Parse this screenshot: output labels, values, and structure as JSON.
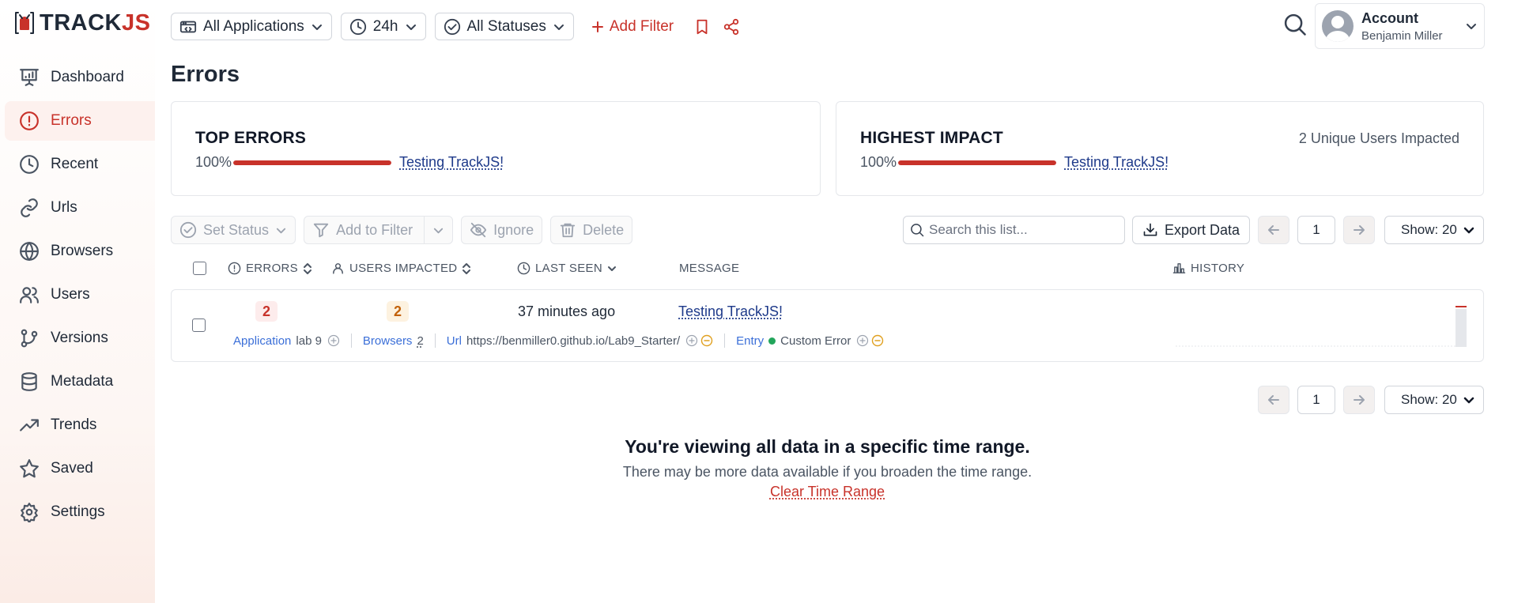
{
  "brand": {
    "prefix": "TRACK",
    "suffix": "JS"
  },
  "nav": [
    {
      "label": "Dashboard",
      "icon": "presentation-icon"
    },
    {
      "label": "Errors",
      "icon": "alert-circle-icon",
      "active": true
    },
    {
      "label": "Recent",
      "icon": "clock-icon"
    },
    {
      "label": "Urls",
      "icon": "link-icon"
    },
    {
      "label": "Browsers",
      "icon": "globe-icon"
    },
    {
      "label": "Users",
      "icon": "users-icon"
    },
    {
      "label": "Versions",
      "icon": "git-branch-icon"
    },
    {
      "label": "Metadata",
      "icon": "database-icon"
    },
    {
      "label": "Trends",
      "icon": "trend-icon"
    },
    {
      "label": "Saved",
      "icon": "star-icon"
    },
    {
      "label": "Settings",
      "icon": "gear-icon"
    }
  ],
  "topbar": {
    "applications": "All Applications",
    "range": "24h",
    "statuses": "All Statuses",
    "add_filter": "Add Filter"
  },
  "account": {
    "title": "Account",
    "user": "Benjamin Miller"
  },
  "page": {
    "title": "Errors"
  },
  "top_errors": {
    "title": "TOP ERRORS",
    "percent_label": "100%",
    "fill": 1.0,
    "message": "Testing TrackJS!"
  },
  "highest_impact": {
    "title": "HIGHEST IMPACT",
    "percent_label": "100%",
    "fill": 1.0,
    "message": "Testing TrackJS!",
    "summary": "2 Unique Users Impacted"
  },
  "toolbar": {
    "set_status": "Set Status",
    "add_to_filter": "Add to Filter",
    "ignore": "Ignore",
    "delete": "Delete",
    "search_placeholder": "Search this list...",
    "export": "Export Data",
    "page": "1",
    "show": "Show: 20"
  },
  "columns": {
    "errors": "ERRORS",
    "users": "USERS IMPACTED",
    "last_seen": "LAST SEEN",
    "message": "MESSAGE",
    "history": "HISTORY"
  },
  "row": {
    "errors": "2",
    "users": "2",
    "last_seen": "37 minutes ago",
    "message": "Testing TrackJS!",
    "application_key": "Application",
    "application_value": "lab 9",
    "browsers_key": "Browsers",
    "browsers_value": "2",
    "url_key": "Url",
    "url_value": "https://benmiller0.github.io/Lab9_Starter/",
    "entry_key": "Entry",
    "entry_value": "Custom Error",
    "history_level": 1.0
  },
  "notice": {
    "title": "You're viewing all data in a specific time range.",
    "subtitle": "There may be more data available if you broaden the time range.",
    "link": "Clear Time Range"
  },
  "colors": {
    "accent": "#c8322a",
    "link": "#1e3a8a",
    "meta_key": "#3b6fd8",
    "entry_dot": "#22a55b"
  }
}
